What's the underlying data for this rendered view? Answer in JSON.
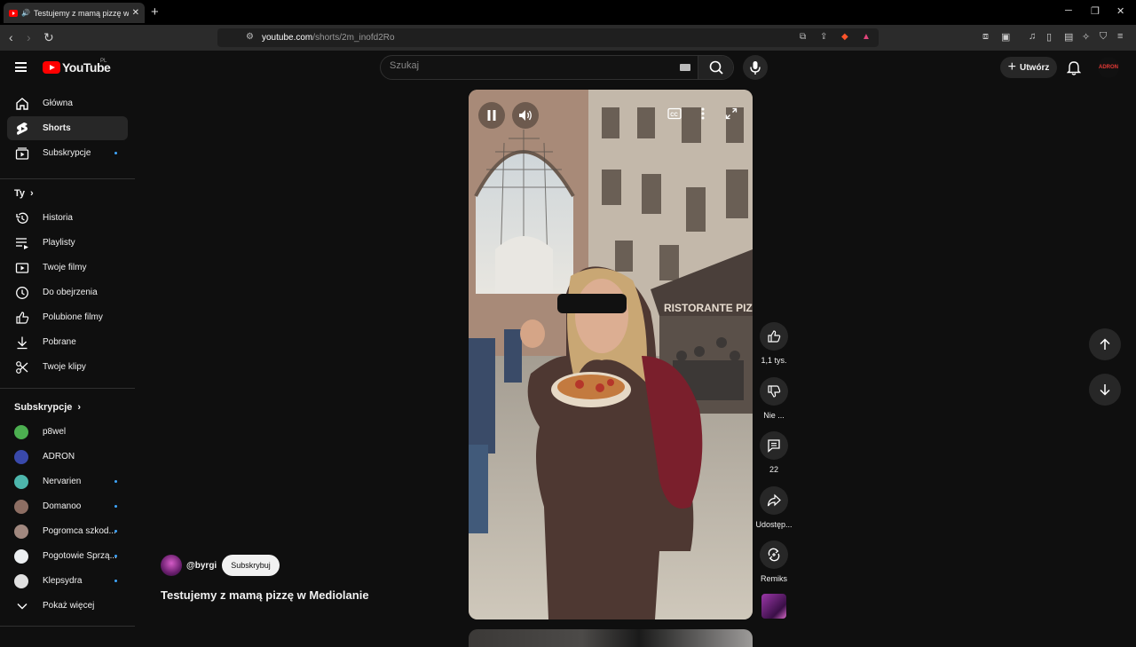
{
  "browser": {
    "tab_title": "Testujemy z mamą pizzę w Me",
    "url_host": "youtube.com",
    "url_path": "/shorts/2m_inofd2Ro"
  },
  "header": {
    "logo_text": "YouTube",
    "country_code": "PL",
    "search_placeholder": "Szukaj",
    "create_label": "Utwórz",
    "avatar_text": "ADRON"
  },
  "sidebar": {
    "main": [
      {
        "label": "Główna",
        "icon": "home-icon"
      },
      {
        "label": "Shorts",
        "icon": "shorts-icon"
      },
      {
        "label": "Subskrypcje",
        "icon": "subscriptions-icon"
      }
    ],
    "you_heading": "Ty",
    "you": [
      {
        "label": "Historia",
        "icon": "history-icon"
      },
      {
        "label": "Playlisty",
        "icon": "playlists-icon"
      },
      {
        "label": "Twoje filmy",
        "icon": "your-videos-icon"
      },
      {
        "label": "Do obejrzenia",
        "icon": "watch-later-icon"
      },
      {
        "label": "Polubione filmy",
        "icon": "liked-icon"
      },
      {
        "label": "Pobrane",
        "icon": "download-icon"
      },
      {
        "label": "Twoje klipy",
        "icon": "clips-icon"
      }
    ],
    "subs_heading": "Subskrypcje",
    "subs": [
      {
        "label": "p8wel",
        "color": "#4caf50"
      },
      {
        "label": "ADRON",
        "color": "#3949ab"
      },
      {
        "label": "Nervarien",
        "color": "#4db6ac"
      },
      {
        "label": "Domanoo",
        "color": "#8d6e63"
      },
      {
        "label": "Pogromca szkod...",
        "color": "#a1887f"
      },
      {
        "label": "Pogotowie Sprzą...",
        "color": "#eceff1"
      },
      {
        "label": "Klepsydra",
        "color": "#e0e0e0"
      }
    ],
    "show_more": "Pokaż więcej"
  },
  "video": {
    "channel": "@byrgi",
    "subscribe_label": "Subskrybuj",
    "title": "Testujemy z mamą pizzę w Mediolanie",
    "sign_text": "RISTORANTE PIZZ"
  },
  "actions": {
    "likes": "1,1 tys.",
    "dislike": "Nie ...",
    "comments": "22",
    "share": "Udostęp...",
    "remix": "Remiks"
  }
}
